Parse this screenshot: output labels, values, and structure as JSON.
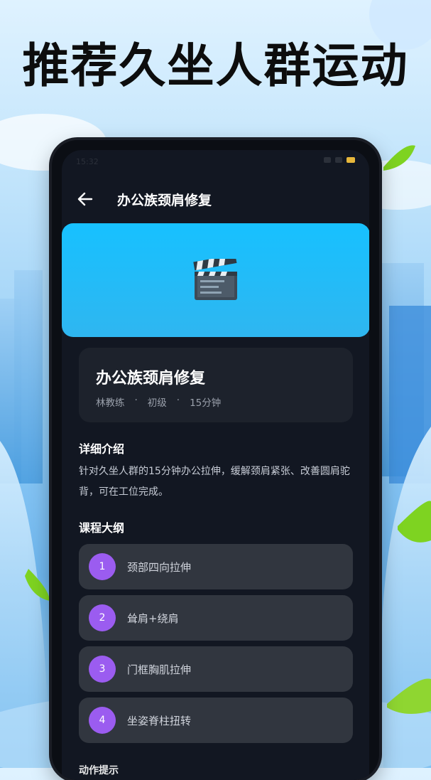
{
  "promo": {
    "headline": "推荐久坐人群运动"
  },
  "status_bar": {
    "time": "15:32"
  },
  "header": {
    "title": "办公族颈肩修复"
  },
  "banner": {
    "icon": "clapperboard-icon"
  },
  "course": {
    "title": "办公族颈肩修复",
    "coach": "林教练",
    "level": "初级",
    "duration": "15分钟",
    "separator": "·"
  },
  "details": {
    "heading": "详细介绍",
    "text": "针对久坐人群的15分钟办公拉伸，缓解颈肩紧张、改善圆肩驼背，可在工位完成。"
  },
  "outline": {
    "heading": "课程大纲",
    "items": [
      {
        "num": "1",
        "label": "颈部四向拉伸"
      },
      {
        "num": "2",
        "label": "耸肩+绕肩"
      },
      {
        "num": "3",
        "label": "门框胸肌拉伸"
      },
      {
        "num": "4",
        "label": "坐姿脊柱扭转"
      }
    ]
  },
  "next_section": {
    "heading": "动作提示"
  },
  "colors": {
    "accent": "#9b5cf0",
    "banner": "#17c1ff",
    "card": "#1d222c",
    "screen": "#121722"
  }
}
